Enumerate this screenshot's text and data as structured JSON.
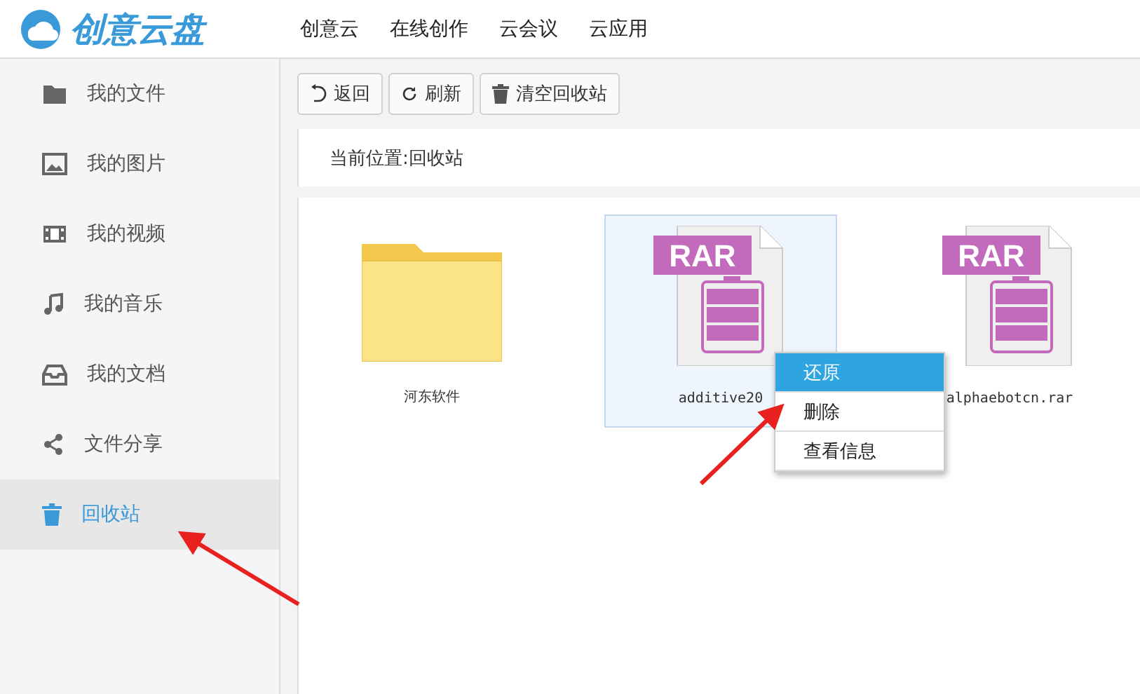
{
  "logo": {
    "text": "创意云盘"
  },
  "nav": [
    {
      "label": "创意云"
    },
    {
      "label": "在线创作"
    },
    {
      "label": "云会议"
    },
    {
      "label": "云应用"
    }
  ],
  "sidebar": {
    "items": [
      {
        "label": "我的文件",
        "kind": "folder",
        "selected": false
      },
      {
        "label": "我的图片",
        "kind": "image",
        "selected": false
      },
      {
        "label": "我的视频",
        "kind": "video",
        "selected": false
      },
      {
        "label": "我的音乐",
        "kind": "music",
        "selected": false
      },
      {
        "label": "我的文档",
        "kind": "inbox",
        "selected": false
      },
      {
        "label": "文件分享",
        "kind": "share",
        "selected": false
      },
      {
        "label": "回收站",
        "kind": "trash",
        "selected": true
      }
    ]
  },
  "toolbar": [
    {
      "label": "返回",
      "kind": "back"
    },
    {
      "label": "刷新",
      "kind": "refresh"
    },
    {
      "label": "清空回收站",
      "kind": "trash"
    }
  ],
  "location": "当前位置:回收站",
  "files": [
    {
      "name": "河东软件",
      "kind": "folder",
      "selected": false
    },
    {
      "name": "additive20",
      "kind": "rar",
      "badge": "RAR",
      "selected": true
    },
    {
      "name": "alphaebotcn.rar",
      "kind": "rar",
      "badge": "RAR",
      "selected": false
    }
  ],
  "context_menu": [
    {
      "label": "还原",
      "selected": true
    },
    {
      "label": "删除",
      "selected": false
    },
    {
      "label": "查看信息",
      "selected": false
    }
  ]
}
